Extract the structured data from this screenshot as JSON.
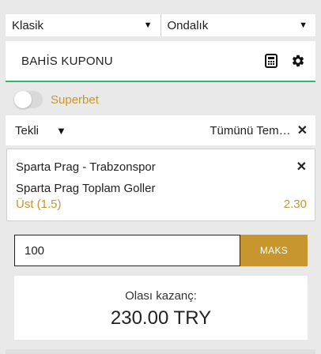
{
  "dropdowns": {
    "odds_style": "Klasik",
    "odds_format": "Ondalık",
    "arrow": "▼"
  },
  "header": {
    "title": "BAHİS KUPONU",
    "icons": [
      "calculator-icon",
      "gear-icon"
    ]
  },
  "superbet": {
    "label": "Superbet",
    "enabled": false
  },
  "bet_type": {
    "selected": "Tekli",
    "arrow": "▼",
    "clear_all_label": "Tümünü Tem…",
    "clear_icon": "✕"
  },
  "selection": {
    "match": "Sparta Prag - Trabzonspor",
    "market": "Sparta Prag Toplam Goller",
    "pick": "Üst (1.5)",
    "odds": "2.30",
    "remove_icon": "✕"
  },
  "stake": {
    "value": "100",
    "max_label": "MAKS"
  },
  "potential_win": {
    "label": "Olası kazanç:",
    "value": "230.00 TRY"
  },
  "colors": {
    "accent_gold": "#c8962e",
    "green_line": "#3bb46a",
    "background": "#e9e9e9"
  }
}
